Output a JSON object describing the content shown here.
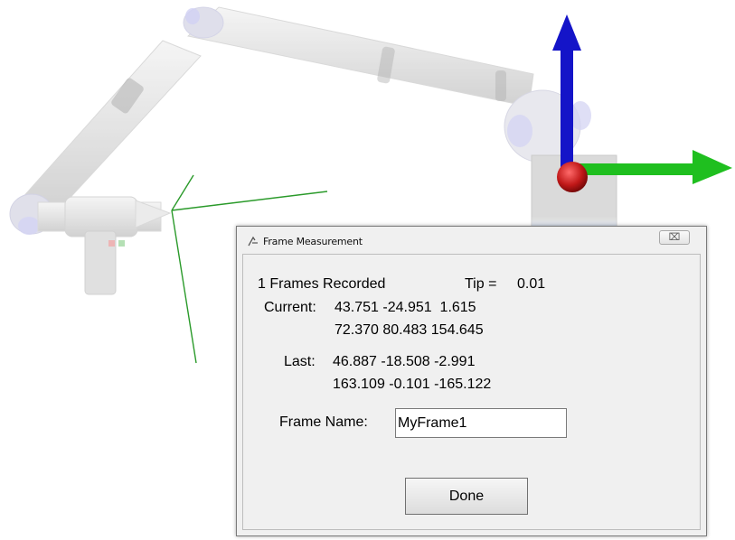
{
  "dialog": {
    "title": "Frame Measurement",
    "close_glyph": "⌧",
    "frames_recorded": "1 Frames Recorded",
    "tip_label": "Tip =",
    "tip_value": "0.01",
    "current_label": "Current:",
    "current_line1": "43.751 -24.951  1.615",
    "current_line2": "72.370 80.483 154.645",
    "last_label": "Last:",
    "last_line1": "46.887 -18.508 -2.991",
    "last_line2": "163.109 -0.101 -165.122",
    "frame_name_label": "Frame Name:",
    "frame_name_value": "MyFrame1",
    "done_label": "Done"
  },
  "scene": {
    "axis_colors": {
      "x": "#1fbf1f",
      "z": "#1414c8",
      "origin": "#b01010"
    },
    "probe_axis_color": "#2a9a2a"
  }
}
